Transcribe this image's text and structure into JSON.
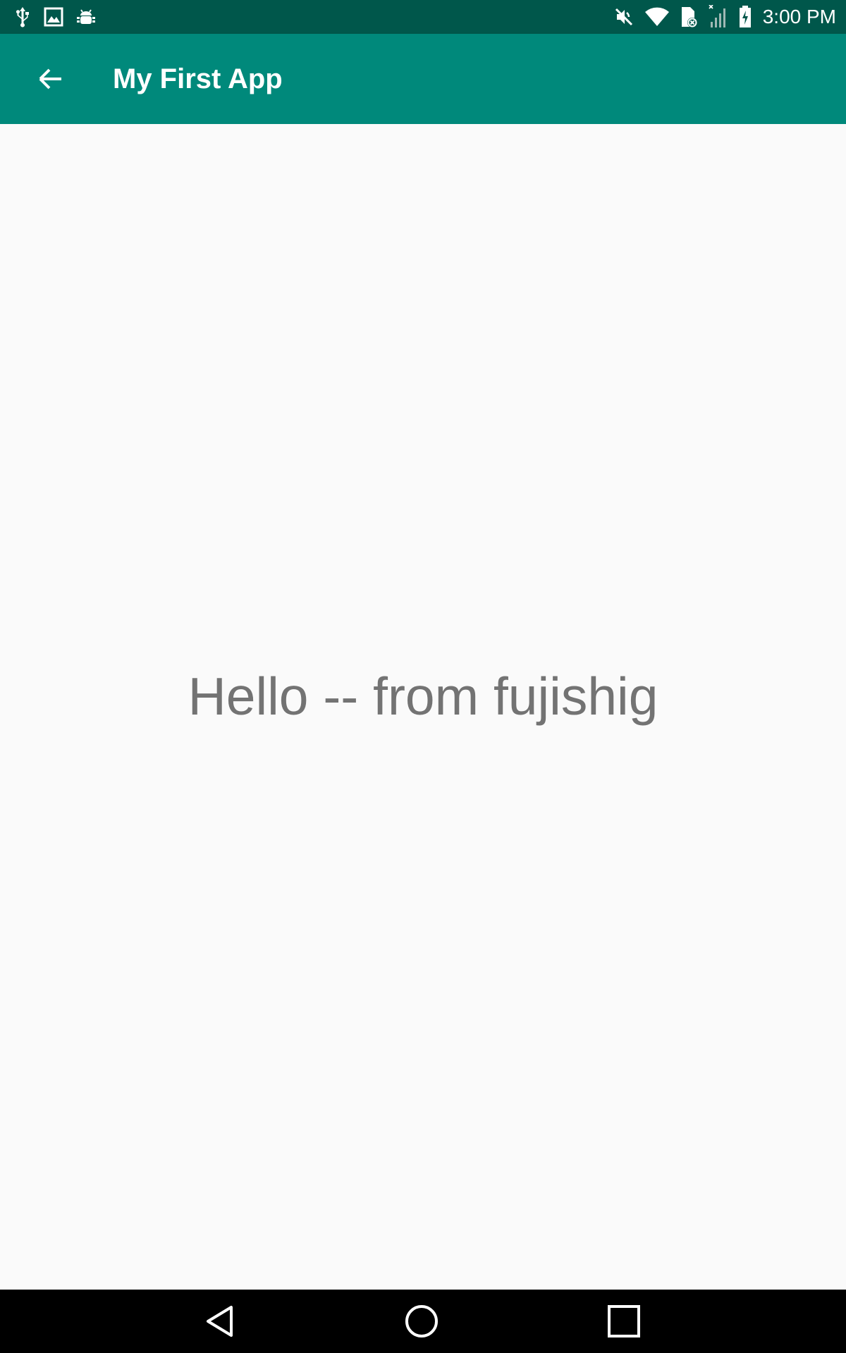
{
  "status_bar": {
    "time": "3:00 PM",
    "left_icons": [
      "usb-icon",
      "image-icon",
      "android-debug-icon"
    ],
    "right_icons": [
      "mute-icon",
      "wifi-icon",
      "sim-error-icon",
      "signal-icon",
      "battery-charging-icon"
    ]
  },
  "app_bar": {
    "title": "My First App",
    "background": "#00897b",
    "back_icon": "arrow-back-icon"
  },
  "content": {
    "message": "Hello -- from fujishig"
  },
  "nav_bar": {
    "buttons": [
      "back-triangle-icon",
      "home-circle-icon",
      "recents-square-icon"
    ]
  },
  "colors": {
    "status_bar": "#00574b",
    "app_bar": "#00897b",
    "background": "#fafafa",
    "text": "#737373"
  }
}
